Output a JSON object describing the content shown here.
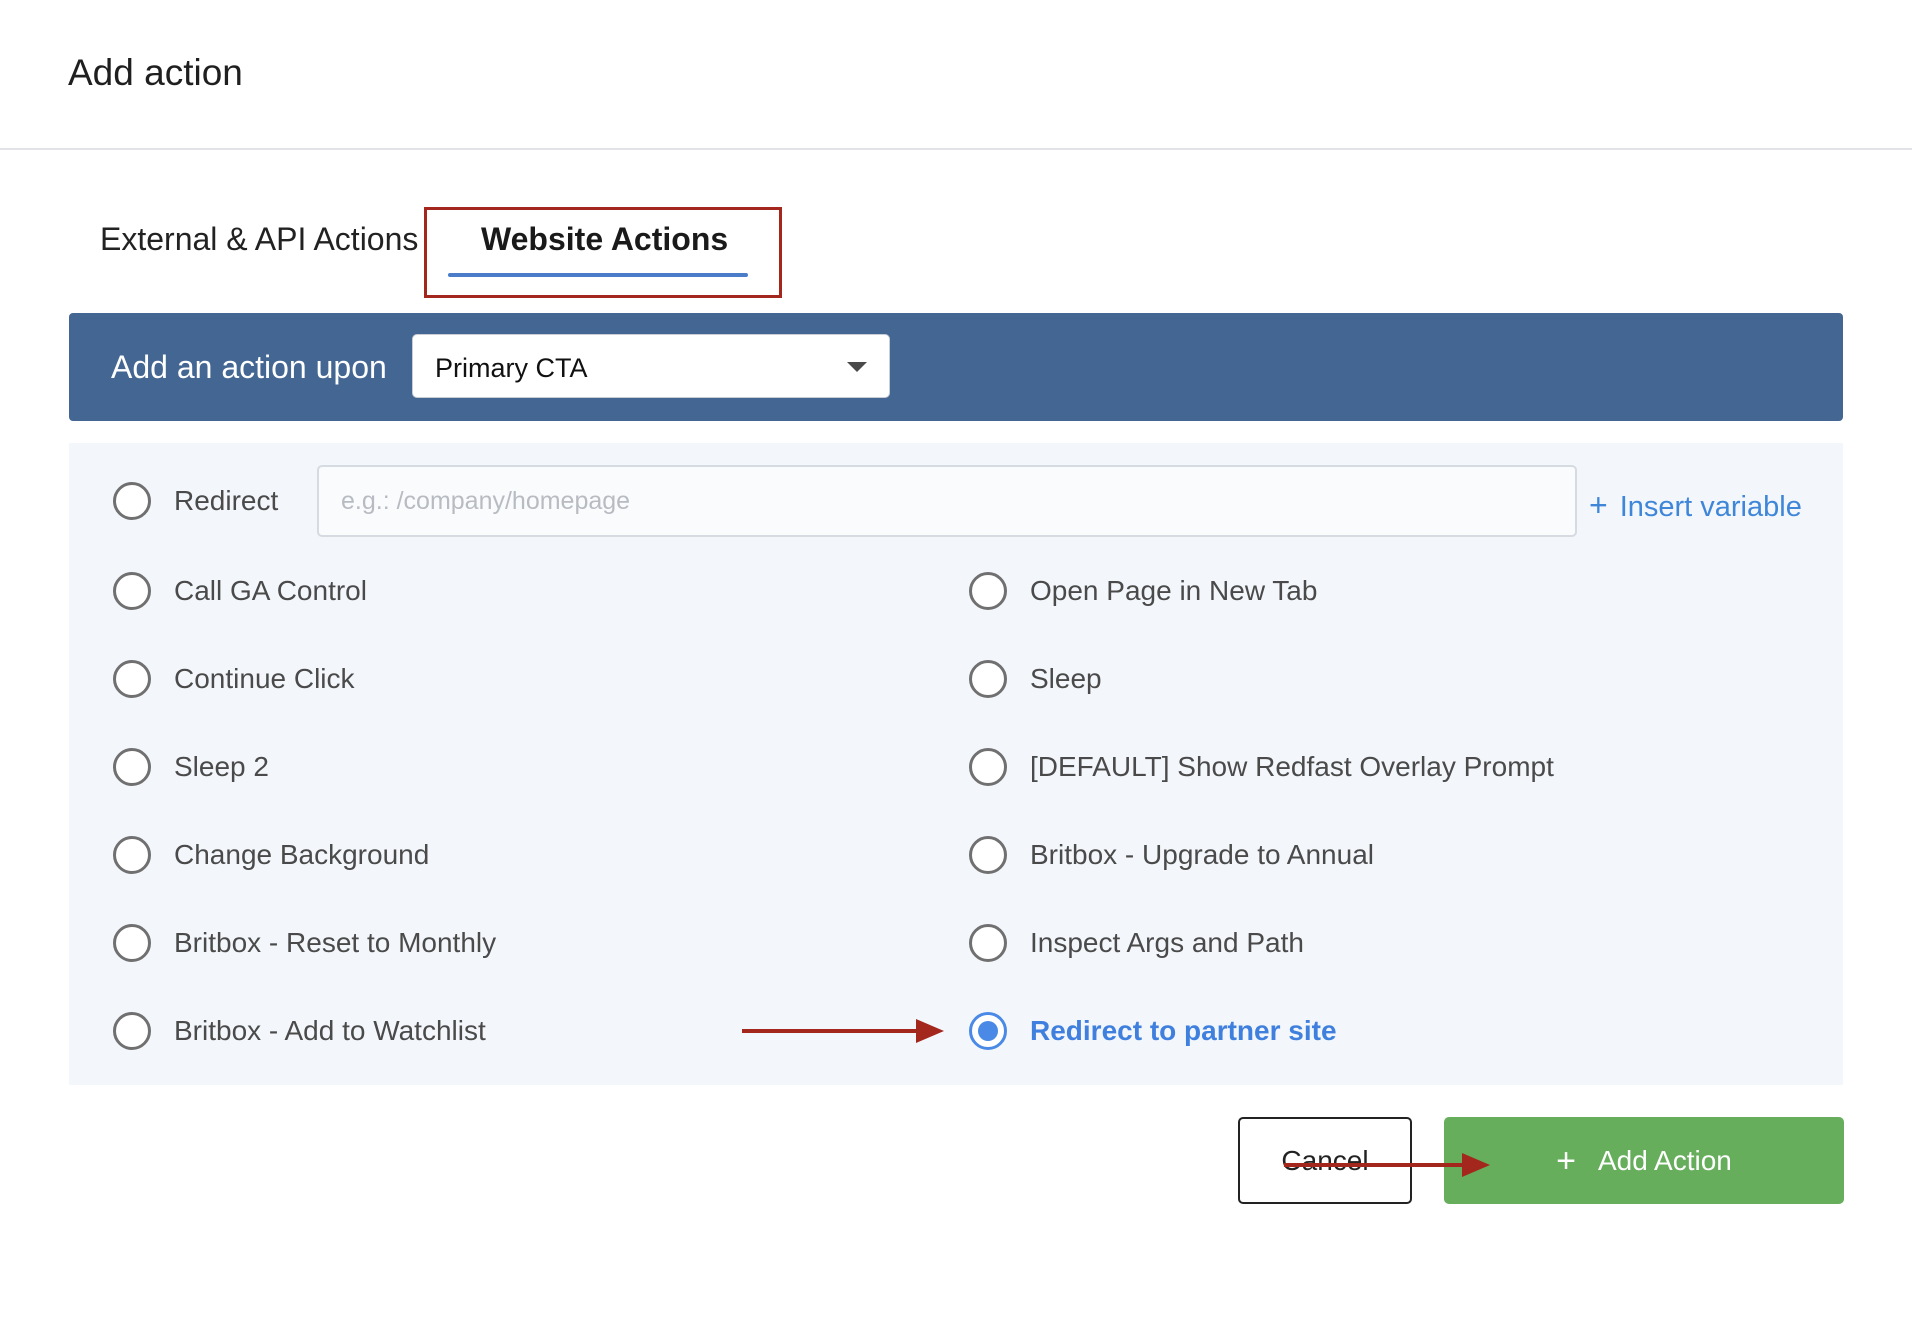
{
  "modal": {
    "title": "Add action"
  },
  "tabs": [
    {
      "label": "External & API Actions",
      "active": false
    },
    {
      "label": "Website Actions",
      "active": true
    }
  ],
  "action_bar": {
    "label": "Add an action upon",
    "select_value": "Primary CTA"
  },
  "redirect": {
    "label": "Redirect",
    "placeholder": "e.g.: /company/homepage",
    "value": "",
    "insert_variable": "Insert variable",
    "insert_variable_icon": "plus-icon"
  },
  "options_left": [
    {
      "label": "Call GA Control",
      "selected": false
    },
    {
      "label": "Continue Click",
      "selected": false
    },
    {
      "label": "Sleep 2",
      "selected": false
    },
    {
      "label": "Change Background",
      "selected": false
    },
    {
      "label": "Britbox - Reset to Monthly",
      "selected": false
    },
    {
      "label": "Britbox - Add to Watchlist",
      "selected": false
    }
  ],
  "options_right": [
    {
      "label": "Open Page in New Tab",
      "selected": false
    },
    {
      "label": "Sleep",
      "selected": false
    },
    {
      "label": "[DEFAULT] Show Redfast Overlay Prompt",
      "selected": false
    },
    {
      "label": "Britbox - Upgrade to Annual",
      "selected": false
    },
    {
      "label": "Inspect Args and Path",
      "selected": false
    },
    {
      "label": "Redirect to partner site",
      "selected": true
    }
  ],
  "buttons": {
    "cancel": "Cancel",
    "add": "Add Action",
    "add_icon": "plus-icon"
  },
  "colors": {
    "action_bar": "#436693",
    "selected_accent": "#4a8ae6",
    "add_button": "#66ae5b",
    "annotation": "#a3271d",
    "link": "#3f86d9"
  },
  "annotations": [
    "highlight-box-website-tab",
    "arrow-to-redirect-partner",
    "arrow-to-add-action"
  ]
}
